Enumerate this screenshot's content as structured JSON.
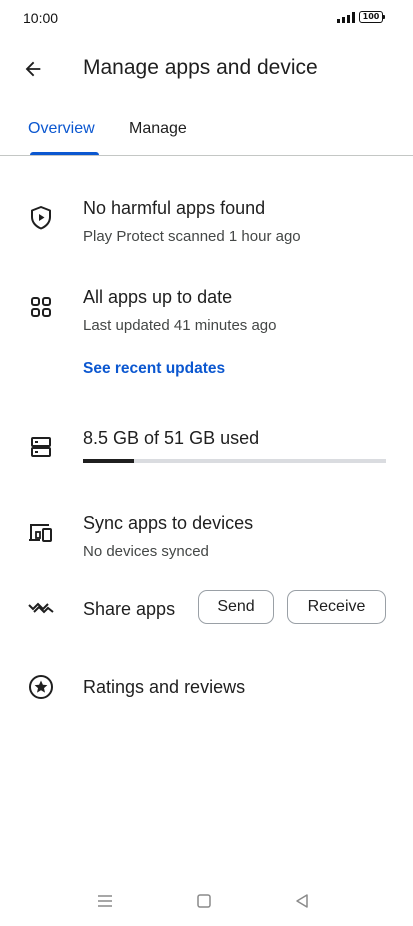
{
  "status_bar": {
    "time": "10:00",
    "battery": "100"
  },
  "header": {
    "title": "Manage apps and device",
    "back_icon": "arrow-back-icon"
  },
  "tabs": [
    {
      "label": "Overview",
      "selected": true
    },
    {
      "label": "Manage",
      "selected": false
    }
  ],
  "overview": {
    "protect": {
      "icon": "play-protect-shield-icon",
      "title": "No harmful apps found",
      "subtitle": "Play Protect scanned 1 hour ago"
    },
    "updates": {
      "icon": "apps-grid-icon",
      "title": "All apps up to date",
      "subtitle": "Last updated 41 minutes ago",
      "link": "See recent updates"
    },
    "storage": {
      "icon": "storage-icon",
      "title": "8.5 GB of 51 GB used",
      "used_fraction": 0.167
    },
    "sync": {
      "icon": "devices-icon",
      "title": "Sync apps to devices",
      "subtitle": "No devices synced"
    },
    "share": {
      "icon": "share-apps-icon",
      "title": "Share apps",
      "send_label": "Send",
      "receive_label": "Receive"
    },
    "ratings": {
      "icon": "star-circle-icon",
      "title": "Ratings and reviews"
    }
  },
  "colors": {
    "accent": "#0b57d0",
    "text": "#1f1f1f",
    "secondary_text": "#444746"
  },
  "nav_bar": {
    "icons": [
      "menu-icon",
      "home-square-icon",
      "back-triangle-icon"
    ]
  }
}
